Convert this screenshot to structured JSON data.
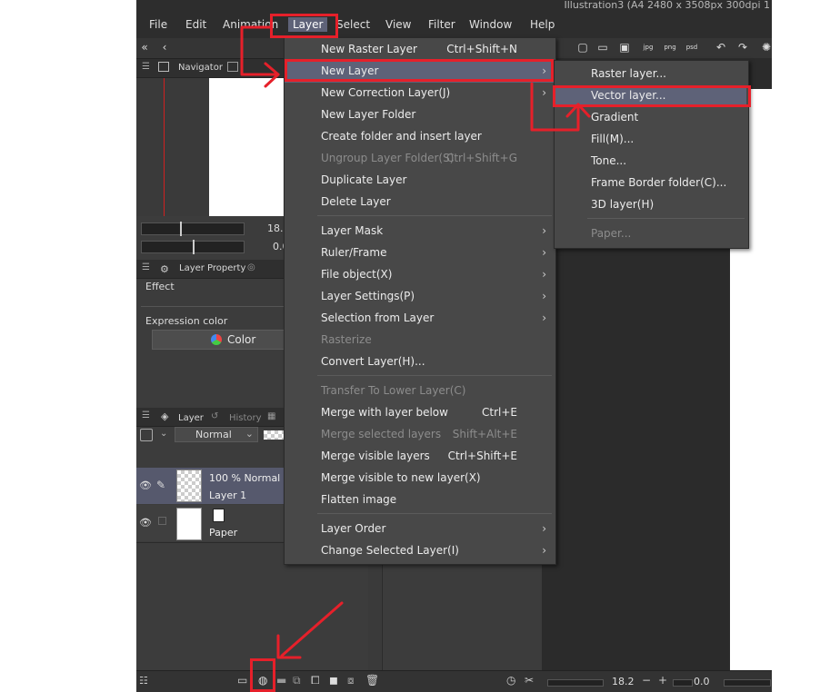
{
  "window": {
    "title": "Illustration3 (A4 2480 x 3508px 300dpi 1"
  },
  "menubar": {
    "items": [
      "File",
      "Edit",
      "Animation",
      "Layer",
      "Select",
      "View",
      "Filter",
      "Window",
      "Help"
    ],
    "active": "Layer"
  },
  "navigator": {
    "tab": "Navigator",
    "zoom": "18.2",
    "rotate": "0.0"
  },
  "layer_property": {
    "tab": "Layer Property",
    "effect_label": "Effect",
    "expression_label": "Expression color",
    "color_button": "Color"
  },
  "layer_panel": {
    "tab_layer": "Layer",
    "tab_history": "History",
    "blend_mode": "Normal",
    "layers": [
      {
        "line1": "100 % Normal",
        "line2": "Layer 1"
      },
      {
        "line1": "",
        "line2": "Paper"
      }
    ]
  },
  "layer_menu": [
    {
      "label": "New Raster Layer",
      "shortcut": "Ctrl+Shift+N"
    },
    {
      "label": "New Layer",
      "submenu": true,
      "highlighted": true
    },
    {
      "label": "New Correction Layer(J)",
      "submenu": true
    },
    {
      "label": "New Layer Folder"
    },
    {
      "label": "Create folder and insert layer"
    },
    {
      "label": "Ungroup Layer Folder(S)",
      "shortcut": "Ctrl+Shift+G",
      "disabled": true
    },
    {
      "label": "Duplicate Layer"
    },
    {
      "label": "Delete Layer"
    },
    {
      "label": "Layer Mask",
      "submenu": true
    },
    {
      "label": "Ruler/Frame",
      "submenu": true
    },
    {
      "label": "File object(X)",
      "submenu": true
    },
    {
      "label": "Layer Settings(P)",
      "submenu": true
    },
    {
      "label": "Selection from Layer",
      "submenu": true
    },
    {
      "label": "Rasterize",
      "disabled": true
    },
    {
      "label": "Convert Layer(H)..."
    },
    {
      "label": "Transfer To Lower Layer(C)",
      "disabled": true
    },
    {
      "label": "Merge with layer below",
      "shortcut": "Ctrl+E"
    },
    {
      "label": "Merge selected layers",
      "shortcut": "Shift+Alt+E",
      "disabled": true
    },
    {
      "label": "Merge visible layers",
      "shortcut": "Ctrl+Shift+E"
    },
    {
      "label": "Merge visible to new layer(X)"
    },
    {
      "label": "Flatten image"
    },
    {
      "label": "Layer Order",
      "submenu": true
    },
    {
      "label": "Change Selected Layer(I)",
      "submenu": true
    }
  ],
  "new_layer_submenu": [
    {
      "label": "Raster layer..."
    },
    {
      "label": "Vector layer...",
      "highlighted": true
    },
    {
      "label": "Gradient"
    },
    {
      "label": "Fill(M)..."
    },
    {
      "label": "Tone..."
    },
    {
      "label": "Frame Border folder(C)..."
    },
    {
      "label": "3D layer(H)"
    },
    {
      "label": "Paper...",
      "disabled": true
    }
  ],
  "toolbar_icons": [
    "jpg",
    "png",
    "psd"
  ],
  "status_bar": {
    "zoom": "18.2",
    "rotation": "0.0"
  },
  "annotation_color": "#e6202a"
}
